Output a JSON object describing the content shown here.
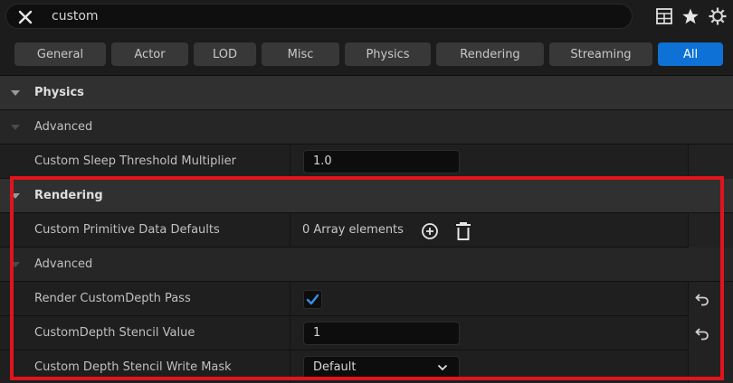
{
  "search": {
    "value": "custom"
  },
  "icons": {
    "clear": "close-icon",
    "table": "table-view-icon",
    "favorite": "star-icon",
    "settings": "gear-icon"
  },
  "tabs": [
    {
      "label": "General"
    },
    {
      "label": "Actor"
    },
    {
      "label": "LOD"
    },
    {
      "label": "Misc"
    },
    {
      "label": "Physics"
    },
    {
      "label": "Rendering"
    },
    {
      "label": "Streaming"
    },
    {
      "label": "All",
      "active": true
    }
  ],
  "rows": {
    "physics": {
      "label": "Physics"
    },
    "physics_advanced": {
      "label": "Advanced"
    },
    "sleep_threshold": {
      "label": "Custom Sleep Threshold Multiplier",
      "value": "1.0"
    },
    "rendering": {
      "label": "Rendering"
    },
    "primitive_data": {
      "label": "Custom Primitive Data Defaults",
      "value": "0 Array elements"
    },
    "rendering_advanced": {
      "label": "Advanced"
    },
    "render_custom_depth": {
      "label": "Render CustomDepth Pass",
      "checked": true
    },
    "stencil_value": {
      "label": "CustomDepth Stencil Value",
      "value": "1"
    },
    "stencil_mask": {
      "label": "Custom Depth Stencil Write Mask",
      "value": "Default"
    }
  },
  "colors": {
    "accent": "#0e71d6",
    "highlight_border": "#e0141c",
    "checkmark": "#3a8ee6"
  }
}
